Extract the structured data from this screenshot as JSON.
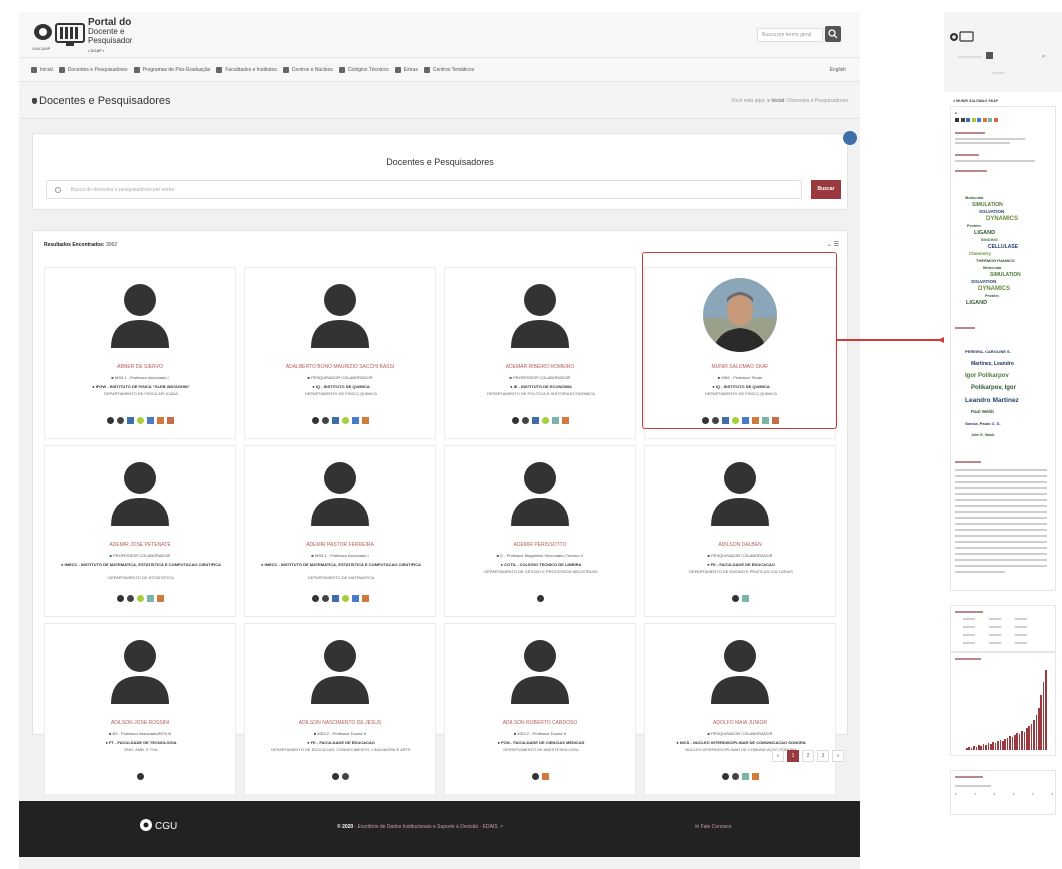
{
  "header": {
    "portal_line1": "Portal do",
    "portal_line2": "Docente e",
    "portal_line3": "Pesquisador",
    "portal_line4": "• DGAP •",
    "unicamp": "UNICAMP",
    "search_placeholder": "Busca por termo geral"
  },
  "nav": {
    "items": [
      {
        "label": "Inicial",
        "icon": "home-icon"
      },
      {
        "label": "Docentes e Pesquisadores",
        "icon": "people-icon"
      },
      {
        "label": "Programas de Pós-Graduação",
        "icon": "graduation-icon"
      },
      {
        "label": "Faculdades e Institutos",
        "icon": "building-icon"
      },
      {
        "label": "Centros e Núcleos",
        "icon": "center-icon"
      },
      {
        "label": "Colégios Técnicos",
        "icon": "school-icon"
      },
      {
        "label": "Extras",
        "icon": "extras-icon"
      },
      {
        "label": "Centros Temáticos",
        "icon": "theme-icon"
      }
    ],
    "english": "English"
  },
  "pagebar": {
    "title": "Docentes e Pesquisadores",
    "crumb_prefix": "Você está aqui:",
    "crumb_home": "Inicial",
    "crumb_current": "Docentes e Pesquisadores"
  },
  "search": {
    "title": "Docentes e Pesquisadores",
    "placeholder": "Busca de docentes e pesquisadores por nome",
    "button": "Buscar"
  },
  "results": {
    "label": "Resultados Encontrados:",
    "count": "3062",
    "cards": [
      {
        "name": "ABNER DE SIERVO",
        "role": "MS5.1 - Professor Associado I",
        "inst": "IFGW - INSTITUTO DE FISICA \"GLEB WATAGHIN\"",
        "dept": "DEPARTAMENTO DE FISICA APLICADA",
        "photo": false,
        "icons": [
          "dspace-icon",
          "cv-icon",
          "lattes-icon",
          "orcid-icon",
          "scholar-icon",
          "scopus-icon",
          "publons-icon"
        ]
      },
      {
        "name": "ADALBERTO BONO MAURIZIO SACCHI BASSI",
        "role": "PESQUISADOR COLABORADOR",
        "inst": "IQ - INSTITUTO DE QUIMICA",
        "dept": "DEPARTAMENTO DE FISICO-QUIMICA",
        "photo": false,
        "icons": [
          "dspace-icon",
          "cv-icon",
          "lattes-icon",
          "orcid-icon",
          "scholar-icon",
          "scopus-icon"
        ]
      },
      {
        "name": "ADEMAR RIBEIRO ROMEIRO",
        "role": "PROFESSOR COLABORADOR",
        "inst": "IE - INSTITUTO DE ECONOMIA",
        "dept": "DEPARTAMENTO DE POLITICA E HISTORIA ECONOMICA",
        "photo": false,
        "icons": [
          "dspace-icon",
          "cv-icon",
          "lattes-icon",
          "orcid-icon",
          "rg-icon",
          "scopus-icon"
        ]
      },
      {
        "name": "MUNIR SALOMAO SKAF",
        "role": "MS6 - Professor Titular",
        "inst": "IQ - INSTITUTO DE QUIMICA",
        "dept": "DEPARTAMENTO DE FISICO-QUIMICA",
        "photo": true,
        "icons": [
          "dspace-icon",
          "cv-icon",
          "lattes-icon",
          "orcid-icon",
          "scholar-icon",
          "scopus-icon",
          "rg-icon",
          "publons-icon"
        ]
      },
      {
        "name": "ADEMIR JOSE PETENATE",
        "role": "PROFESSOR COLABORADOR",
        "inst": "IMECC - INSTITUTO DE MATEMATICA, ESTATISTICA E COMPUTACAO CIENTIFICA",
        "dept": "DEPARTAMENTO DE ESTATISTICA",
        "photo": false,
        "icons": [
          "dspace-icon",
          "cv-icon",
          "orcid-icon",
          "rg-icon",
          "scopus-icon"
        ]
      },
      {
        "name": "ADEMIR PASTOR FERREIRA",
        "role": "MS5.1 - Professor Associado I",
        "inst": "IMECC - INSTITUTO DE MATEMATICA, ESTATISTICA E COMPUTACAO CIENTIFICA",
        "dept": "DEPARTAMENTO DE MATEMATICA",
        "photo": false,
        "icons": [
          "dspace-icon",
          "cv-icon",
          "lattes-icon",
          "orcid-icon",
          "scholar-icon",
          "scopus-icon"
        ]
      },
      {
        "name": "ADEMIR PERISSOTTO",
        "role": "D - Professor Magistério Secundário Técnico V",
        "inst": "COTIL - COLEGIO TECNICO DE LIMEIRA",
        "dept": "DEPARTAMENTO DE GESTAO E PROCESSOS INDUSTRIAIS",
        "photo": false,
        "icons": [
          "dspace-icon"
        ]
      },
      {
        "name": "ADILSON DALBEN",
        "role": "PESQUISADOR COLABORADOR",
        "inst": "FE - FACULDADE DE EDUCACAO",
        "dept": "DEPARTAMENTO DE ENSINO E PRATICAS CULTURAIS",
        "photo": false,
        "icons": [
          "dspace-icon",
          "rg-icon"
        ]
      },
      {
        "name": "ADILSON JOSE ROSSINI",
        "role": "B3 - Professor Associado/MTS-B",
        "inst": "FT - FACULDADE DE TECNOLOGIA",
        "dept": "ENG. AMB. E TXA",
        "photo": false,
        "icons": [
          "dspace-icon"
        ]
      },
      {
        "name": "ADILSON NASCIMENTO DE JESUS",
        "role": "MS3.2 - Professor Doutor II",
        "inst": "FE - FACULDADE DE EDUCACAO",
        "dept": "DEPARTAMENTO DE EDUCACAO, CONHECIMENTO, LINGUAGEM E ARTE",
        "photo": false,
        "icons": [
          "dspace-icon",
          "cv-icon"
        ]
      },
      {
        "name": "ADILSON ROBERTO CARDOSO",
        "role": "MS3.2 - Professor Doutor II",
        "inst": "FCM - FACULDADE DE CIENCIAS MEDICAS",
        "dept": "DEPARTAMENTO DE ANESTESIOLOGIA",
        "photo": false,
        "icons": [
          "dspace-icon",
          "scopus-icon"
        ]
      },
      {
        "name": "ADOLFO MAIA JUNIOR",
        "role": "PESQUISADOR COLABORADOR",
        "inst": "NICS - NUCLEO INTERDISCIPLINAR DE COMUNICACAO SONORA",
        "dept": "NUCLEO INTERDISCIPLINAR DE COMUNICACAO SONORA",
        "photo": false,
        "icons": [
          "dspace-icon",
          "cv-icon",
          "rg-icon",
          "scopus-icon"
        ]
      }
    ]
  },
  "pagination": {
    "pages": [
      "«",
      "1",
      "2",
      "3",
      "»"
    ],
    "active": "1"
  },
  "footer": {
    "copyright": "© 2020",
    "text": "- Escritório de Dados Institucionais e Suporte à Decisão - EDAIS",
    "contact": "Fale Conosco",
    "cgu": "CGU"
  },
  "detail": {
    "title": "MUNIR SALOMAO SKAF",
    "wordcloud": [
      "Molecular",
      "SIMULATION",
      "SOLVATION",
      "DYNAMICS",
      "Protein",
      "LIGAND",
      "BINDING",
      "CELLULASE",
      "Chemistry",
      "THERMODYNAMICS"
    ],
    "coauthors": [
      "PEREIRA, CAROLINE S.",
      "Martinez, Leandro",
      "Igor Polikarpov",
      "Polikarpov, Igor",
      "Leandro Martinez",
      "Paul Webb",
      "Garcia, Paulo C. S.",
      "John E. Staub"
    ]
  },
  "colors": {
    "accent": "#9a3a3f",
    "name_text": "#b35a5f",
    "highlight": "#c83a3a",
    "footer_bg": "#222222"
  }
}
